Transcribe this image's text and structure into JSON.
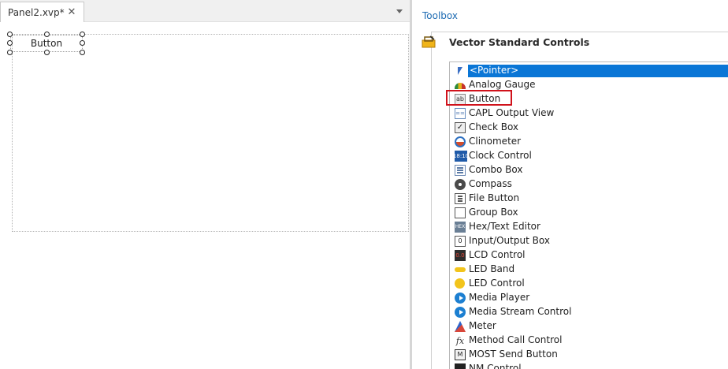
{
  "document": {
    "tab_title": "Panel2.xvp*",
    "close_glyph": "✕",
    "panel_button_label": "Button"
  },
  "toolbox": {
    "title": "Toolbox",
    "group_title": "Vector Standard Controls",
    "items": [
      {
        "label": "<Pointer>",
        "icon": "pointer-icon",
        "selected": true
      },
      {
        "label": "Analog Gauge",
        "icon": "analog-gauge-icon"
      },
      {
        "label": "Button",
        "icon": "button-icon",
        "icon_text": "ab"
      },
      {
        "label": "CAPL Output View",
        "icon": "capl-output-view-icon",
        "icon_text": "=="
      },
      {
        "label": "Check Box",
        "icon": "check-box-icon",
        "icon_text": "✓"
      },
      {
        "label": "Clinometer",
        "icon": "clinometer-icon"
      },
      {
        "label": "Clock Control",
        "icon": "clock-control-icon",
        "icon_text": "18:10"
      },
      {
        "label": "Combo Box",
        "icon": "combo-box-icon"
      },
      {
        "label": "Compass",
        "icon": "compass-icon"
      },
      {
        "label": "File Button",
        "icon": "file-button-icon"
      },
      {
        "label": "Group Box",
        "icon": "group-box-icon"
      },
      {
        "label": "Hex/Text Editor",
        "icon": "hex-text-editor-icon",
        "icon_text": "HEX"
      },
      {
        "label": "Input/Output Box",
        "icon": "input-output-box-icon",
        "icon_text": "0"
      },
      {
        "label": "LCD Control",
        "icon": "lcd-control-icon",
        "icon_text": "0.0"
      },
      {
        "label": "LED Band",
        "icon": "led-band-icon"
      },
      {
        "label": "LED Control",
        "icon": "led-control-icon"
      },
      {
        "label": "Media Player",
        "icon": "media-player-icon"
      },
      {
        "label": "Media Stream Control",
        "icon": "media-stream-control-icon"
      },
      {
        "label": "Meter",
        "icon": "meter-icon"
      },
      {
        "label": "Method Call Control",
        "icon": "method-call-control-icon",
        "icon_text": "fx"
      },
      {
        "label": "MOST Send Button",
        "icon": "most-send-button-icon",
        "icon_text": "M"
      },
      {
        "label": "NM Control",
        "icon": "nm-control-icon"
      }
    ]
  },
  "colors": {
    "selection": "#0a76d6",
    "highlight_box": "#d0121b",
    "toolbox_title": "#1f6cb3"
  }
}
